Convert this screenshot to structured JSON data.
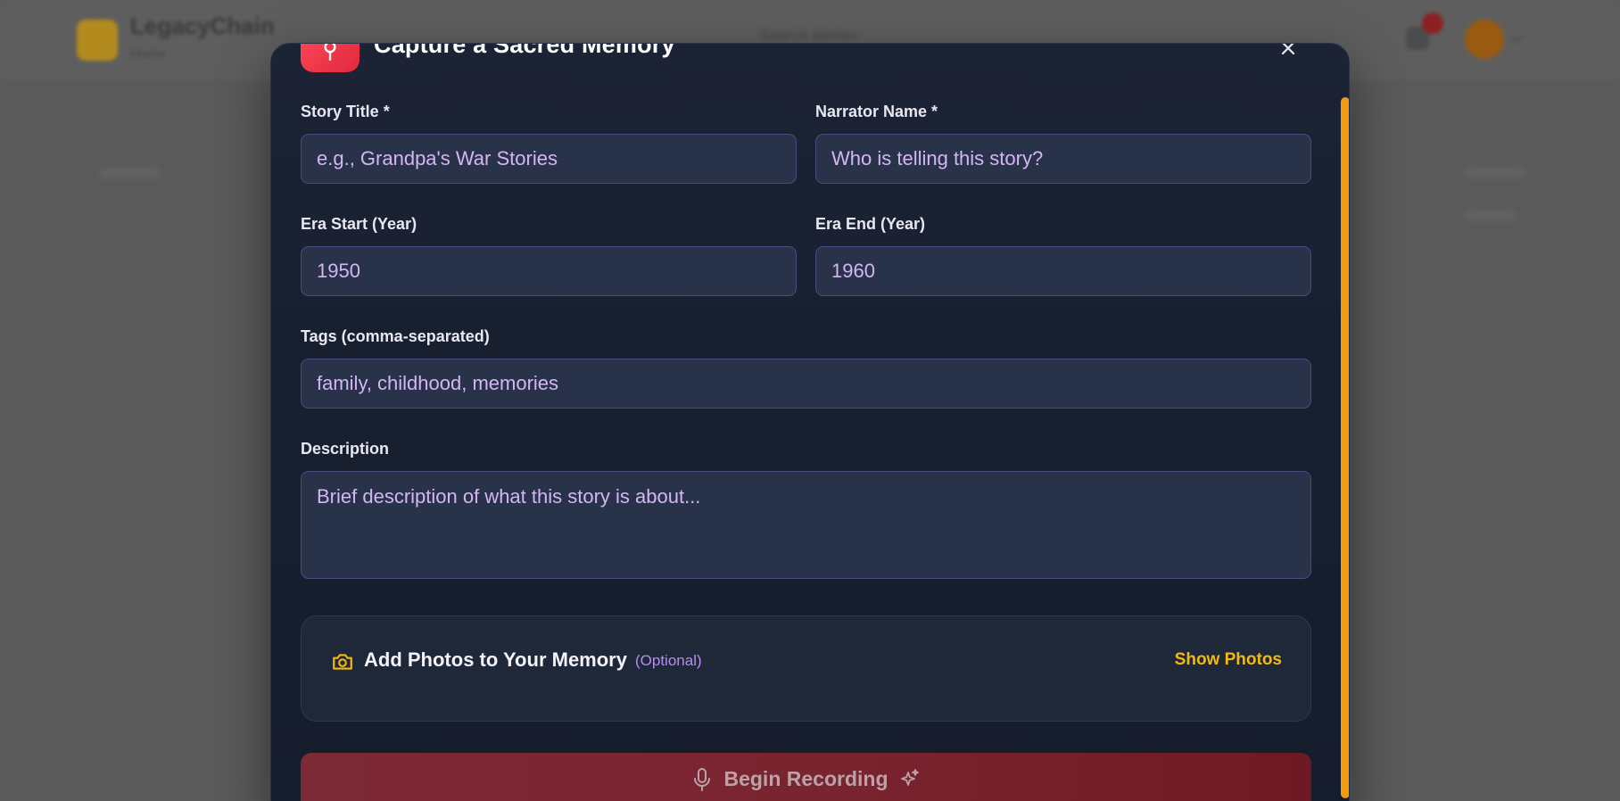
{
  "background": {
    "brand": "LegacyChain",
    "brand_sub": "Home",
    "search_placeholder": "Search stories"
  },
  "modal": {
    "title": "Capture a Sacred Memory",
    "fields": {
      "story_title": {
        "label": "Story Title *",
        "placeholder": "e.g., Grandpa's War Stories"
      },
      "narrator_name": {
        "label": "Narrator Name *",
        "placeholder": "Who is telling this story?"
      },
      "era_start": {
        "label": "Era Start (Year)",
        "placeholder": "1950"
      },
      "era_end": {
        "label": "Era End (Year)",
        "placeholder": "1960"
      },
      "tags": {
        "label": "Tags (comma-separated)",
        "placeholder": "family, childhood, memories"
      },
      "description": {
        "label": "Description",
        "placeholder": "Brief description of what this story is about..."
      }
    },
    "photos": {
      "title": "Add Photos to Your Memory",
      "optional": "(Optional)",
      "toggle_label": "Show Photos"
    },
    "record_label": "Begin Recording"
  },
  "colors": {
    "accent": "#f3b90e",
    "record_button": "#7a2430",
    "scrollbar": "#f29b10",
    "header_icon": "#ff4a5a"
  }
}
